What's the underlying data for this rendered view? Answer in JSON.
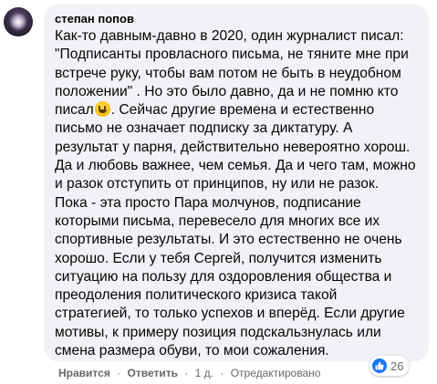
{
  "comment": {
    "author": "степан попов",
    "lines": [
      "Как-то давным-давно в 2020, один журналист писал:",
      "\"Подписанты провласного письма, не тяните мне при",
      "встрече руку, чтобы вам потом не быть в неудобном",
      "положении\" . Но это было давно, да и не помню кто",
      "писал",
      ". Сейчас другие времена и естественно",
      "письмо не означает подписку за диктатуру. А",
      "результат у парня, действительно невероятно хорош.",
      "Да и любовь важнее, чем семья. Да и чего там, можно",
      "и разок отступить от принципов, ну или не разок.",
      "Пока - эта просто Пара молчунов, подписание",
      "которыми письма, перевесело для многих все их",
      "спортивные результаты. И это естественно не очень",
      "хорошо. Если у тебя Сергей, получится изменить",
      "ситуацию на пользу для оздоровления общества и",
      "преодоления политического кризиса такой",
      "стратегией, то только успехов и вперёд. Если другие",
      "мотивы, к примеру позиция подскальзнулась или",
      "смена размера обуви, то мои сожаления."
    ],
    "emoji": "grinning-face-emoji"
  },
  "actions": {
    "like": "Нравится",
    "reply": "Ответить",
    "time": "1 д.",
    "edited": "Отредактировано",
    "separator": "·"
  },
  "reactions": {
    "icon": "thumbs-up-icon",
    "count": "26",
    "color": "#1877f2"
  }
}
